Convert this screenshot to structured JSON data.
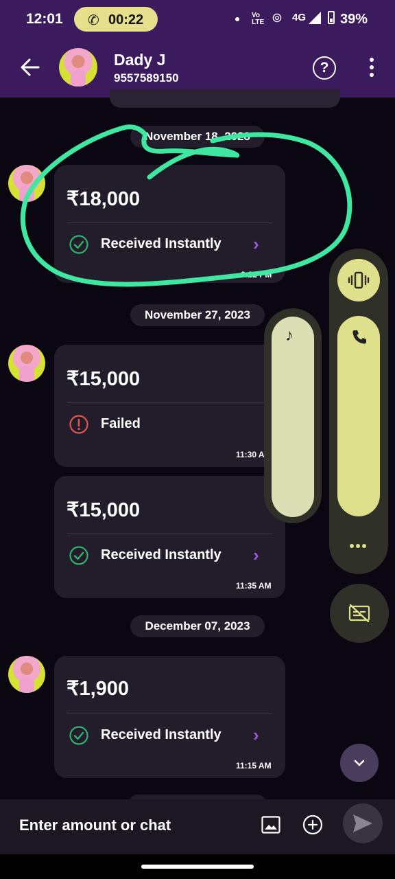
{
  "status_bar": {
    "time": "12:01",
    "call_timer": "00:22",
    "volte": "Vo\nLTE",
    "network": "4G",
    "battery": "39%"
  },
  "header": {
    "contact_name": "Dady J",
    "contact_phone": "9557589150",
    "help_symbol": "?"
  },
  "chat": {
    "dates": [
      "November 18, 2023",
      "November 27, 2023",
      "December 07, 2023"
    ],
    "payments": [
      {
        "amount": "₹18,000",
        "status": "Received Instantly",
        "time": "6:22 PM"
      },
      {
        "amount": "₹15,000",
        "status": "Failed",
        "time": "11:30 AM"
      },
      {
        "amount": "₹15,000",
        "status": "Received Instantly",
        "time": "11:35 AM"
      },
      {
        "amount": "₹1,900",
        "status": "Received Instantly",
        "time": "11:15 AM"
      }
    ]
  },
  "input": {
    "placeholder": "Enter amount or chat"
  },
  "colors": {
    "header": "#3b1b5e",
    "success": "#2fb36b",
    "failed": "#e0564f",
    "accent": "#9a5ae0",
    "volume_panel": "#dfe08b",
    "annotation": "#3fe8a0"
  }
}
